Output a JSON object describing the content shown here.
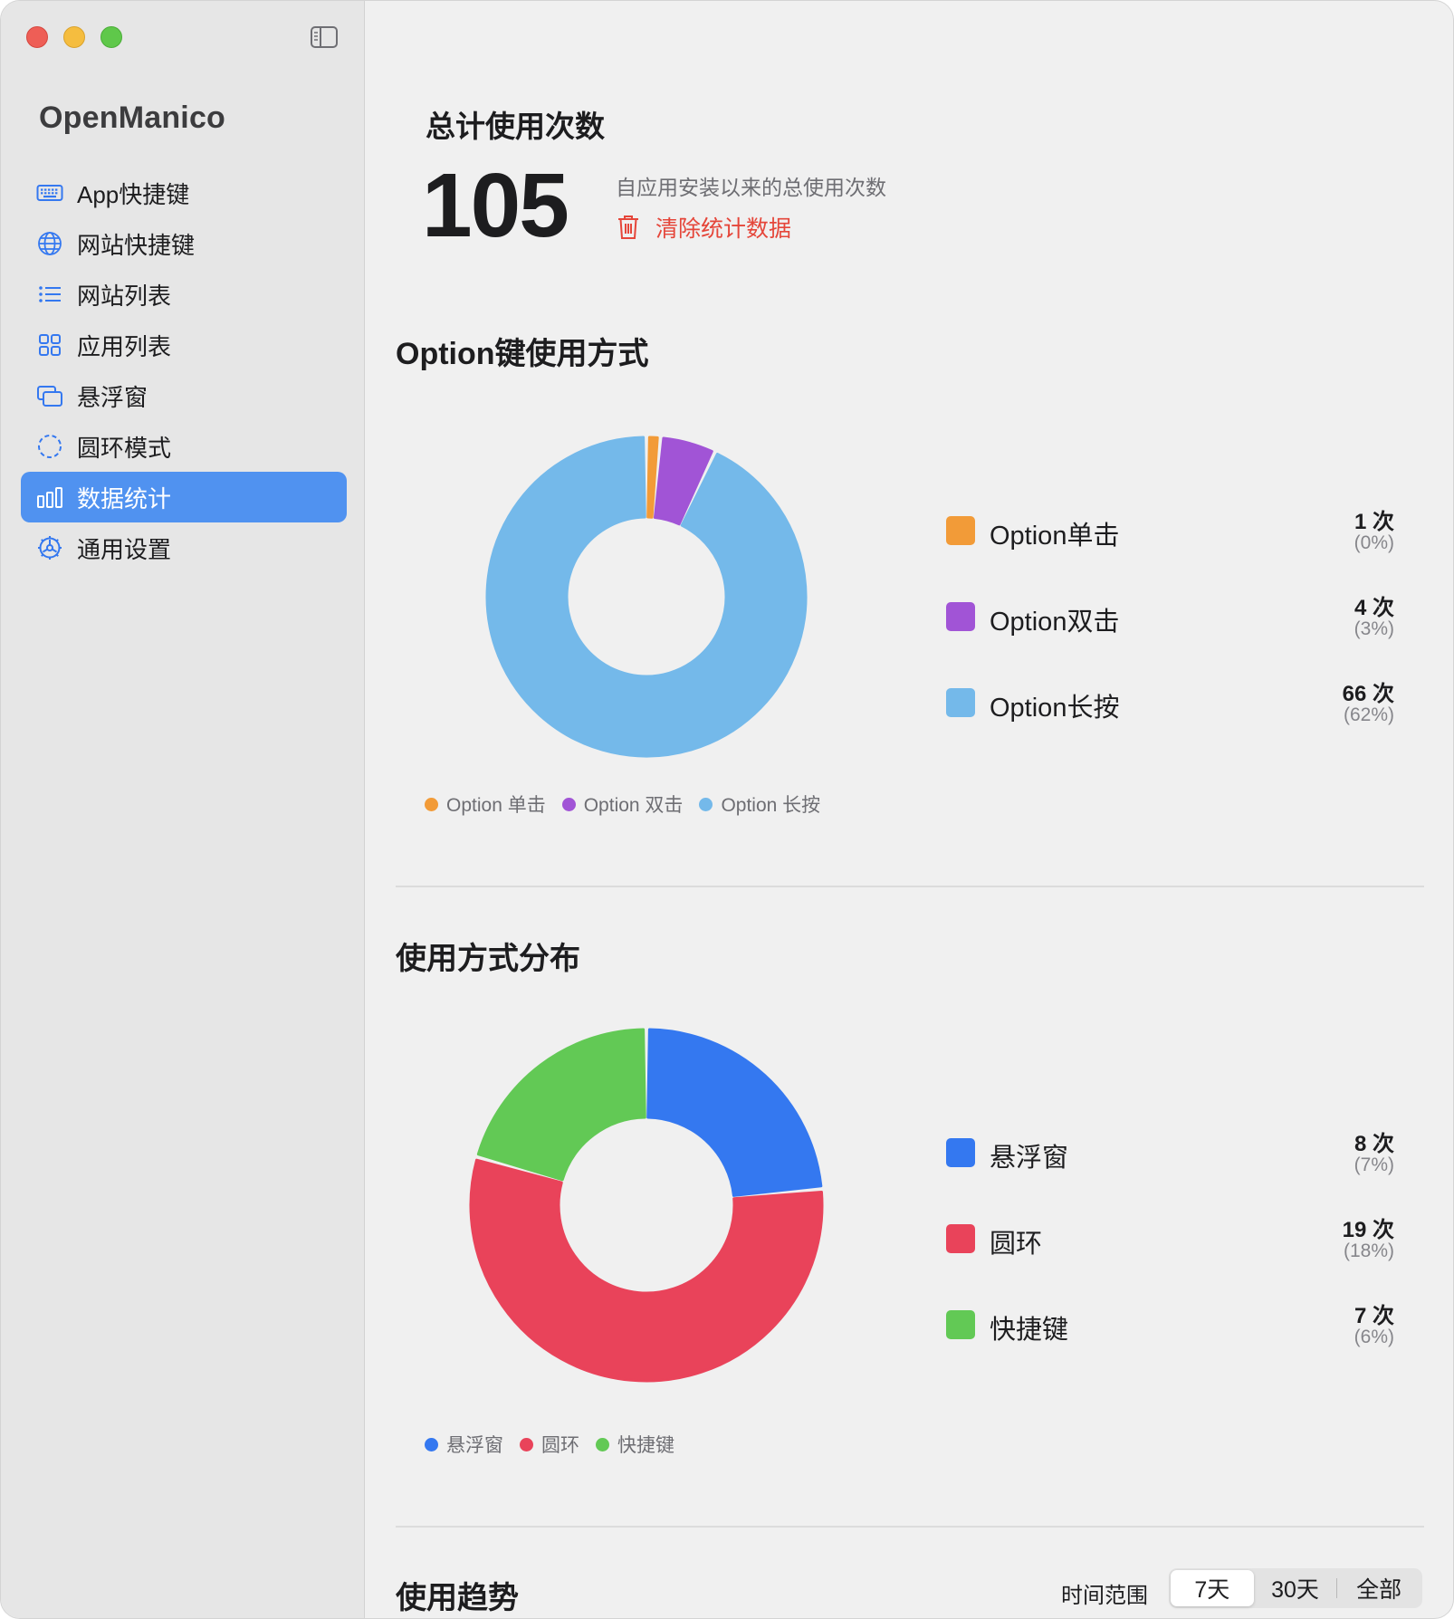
{
  "app": {
    "title": "OpenManico"
  },
  "sidebar": {
    "items": [
      {
        "label": "App快捷键",
        "icon": "keyboard-icon",
        "active": false
      },
      {
        "label": "网站快捷键",
        "icon": "globe-icon",
        "active": false
      },
      {
        "label": "网站列表",
        "icon": "list-icon",
        "active": false
      },
      {
        "label": "应用列表",
        "icon": "grid-icon",
        "active": false
      },
      {
        "label": "悬浮窗",
        "icon": "windows-icon",
        "active": false
      },
      {
        "label": "圆环模式",
        "icon": "dashed-circle-icon",
        "active": false
      },
      {
        "label": "数据统计",
        "icon": "bar-chart-icon",
        "active": true
      },
      {
        "label": "通用设置",
        "icon": "gear-icon",
        "active": false
      }
    ]
  },
  "summary": {
    "title": "总计使用次数",
    "total": "105",
    "description": "自应用安装以来的总使用次数",
    "clear_label": "清除统计数据"
  },
  "option_section": {
    "title": "Option键使用方式",
    "legend": [
      {
        "name": "Option单击",
        "count": "1 次",
        "pct": "(0%)",
        "mini": "Option 单击"
      },
      {
        "name": "Option双击",
        "count": "4 次",
        "pct": "(3%)",
        "mini": "Option 双击"
      },
      {
        "name": "Option长按",
        "count": "66 次",
        "pct": "(62%)",
        "mini": "Option 长按"
      }
    ]
  },
  "mode_section": {
    "title": "使用方式分布",
    "legend": [
      {
        "name": "悬浮窗",
        "count": "8 次",
        "pct": "(7%)",
        "mini": "悬浮窗"
      },
      {
        "name": "圆环",
        "count": "19 次",
        "pct": "(18%)",
        "mini": "圆环"
      },
      {
        "name": "快捷键",
        "count": "7 次",
        "pct": "(6%)",
        "mini": "快捷键"
      }
    ]
  },
  "trend_section": {
    "title": "使用趋势",
    "range_label": "时间范围",
    "ranges": [
      "7天",
      "30天",
      "全部"
    ],
    "selected_range": "7天"
  },
  "colors": {
    "accent": "#5092f0",
    "danger": "#e5463a",
    "option_click": "#f29b38",
    "option_double": "#a154d6",
    "option_long": "#74b9ea",
    "floating": "#3478f0",
    "ring": "#e9435a",
    "shortcut": "#62c955"
  },
  "chart_data": [
    {
      "type": "pie",
      "title": "Option键使用方式",
      "categories": [
        "Option单击",
        "Option双击",
        "Option长按"
      ],
      "values": [
        1,
        4,
        66
      ],
      "colors": [
        "#f29b38",
        "#a154d6",
        "#74b9ea"
      ],
      "donut": true
    },
    {
      "type": "pie",
      "title": "使用方式分布",
      "categories": [
        "悬浮窗",
        "圆环",
        "快捷键"
      ],
      "values": [
        8,
        19,
        7
      ],
      "colors": [
        "#3478f0",
        "#e9435a",
        "#62c955"
      ],
      "donut": true
    }
  ]
}
